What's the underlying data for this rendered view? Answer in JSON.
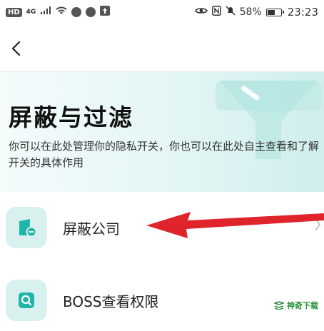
{
  "status_bar": {
    "hd_label": "HD",
    "network_label": "4G",
    "battery_text": "58%",
    "battery_level": 0.58,
    "time": "23:23"
  },
  "header": {
    "back_icon": "chevron-left-icon"
  },
  "hero": {
    "title": "屏蔽与过滤",
    "description": "你可以在此处管理你的隐私开关，你也可以在此处自主查看和了解开关的具体作用",
    "illustration_icon": "funnel-icon"
  },
  "list": {
    "items": [
      {
        "label": "屏蔽公司",
        "icon": "block-company-icon"
      },
      {
        "label": "BOSS查看权限",
        "icon": "search-permission-icon"
      }
    ]
  },
  "watermark": {
    "text": "神奇下载"
  },
  "colors": {
    "accent": "#1fb5a8",
    "hero_bg": "#dff4f3",
    "icon_bg": "#d8f1ef",
    "annotation_arrow": "#e0242b"
  }
}
